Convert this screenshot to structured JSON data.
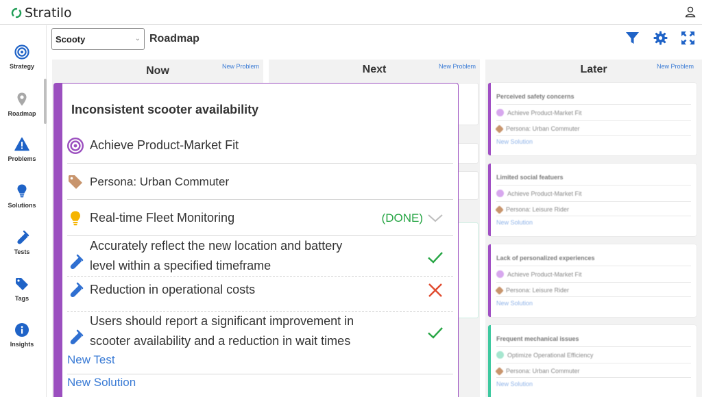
{
  "app": {
    "name": "Stratilo"
  },
  "sidebar": {
    "items": [
      {
        "label": "Strategy",
        "icon": "target-icon"
      },
      {
        "label": "Roadmap",
        "icon": "map-pin-icon"
      },
      {
        "label": "Problems",
        "icon": "warning-icon"
      },
      {
        "label": "Solutions",
        "icon": "lightbulb-icon"
      },
      {
        "label": "Tests",
        "icon": "test-tube-icon"
      },
      {
        "label": "Tags",
        "icon": "tag-icon"
      },
      {
        "label": "Insights",
        "icon": "info-icon"
      }
    ]
  },
  "header": {
    "project": "Scooty",
    "title": "Roadmap",
    "tools": [
      "filter-icon",
      "gear-icon",
      "expand-icon"
    ]
  },
  "columns": [
    {
      "title": "Now",
      "new_problem": "New Problem"
    },
    {
      "title": "Next",
      "new_problem": "New Problem"
    },
    {
      "title": "Later",
      "new_problem": "New Problem"
    }
  ],
  "later_cards": [
    {
      "title": "Perceived safety concerns",
      "goal": "Achieve Product-Market Fit",
      "tag": "Persona: Urban Commuter",
      "new_solution": "New Solution",
      "accent": "#a04fc4"
    },
    {
      "title": "Limited social featuers",
      "goal": "Achieve Product-Market Fit",
      "tag": "Persona: Leisure Rider",
      "new_solution": "New Solution",
      "accent": "#a04fc4"
    },
    {
      "title": "Lack of personalized experiences",
      "goal": "Achieve Product-Market Fit",
      "tag": "Persona: Leisure Rider",
      "new_solution": "New Solution",
      "accent": "#a04fc4"
    },
    {
      "title": "Frequent mechanical issues",
      "goal": "Optimize Operational Efficiency",
      "tag": "Persona: Urban Commuter",
      "new_solution": "New Solution",
      "accent": "#3ec9a0"
    }
  ],
  "card": {
    "title": "Inconsistent scooter availability",
    "goal": "Achieve Product-Market Fit",
    "tag": "Persona: Urban Commuter",
    "solution": {
      "label": "Real-time Fleet Monitoring",
      "status": "(DONE)"
    },
    "tests": [
      {
        "line1": "Accurately reflect the new location and battery",
        "line2": "level within a specified timeframe",
        "result": "pass"
      },
      {
        "line1": "Reduction in operational costs",
        "line2": "",
        "result": "fail"
      },
      {
        "line1": "Users should report a significant improvement in",
        "line2": "scooter availability and a reduction in wait times",
        "result": "pass"
      }
    ],
    "new_test": "New Test",
    "new_solution": "New Solution"
  },
  "colors": {
    "accent_purple": "#9b4fbf",
    "link_blue": "#3a7bd5",
    "icon_blue": "#2f6fd1",
    "done_green": "#26a544",
    "fail_red": "#e04b2f"
  }
}
